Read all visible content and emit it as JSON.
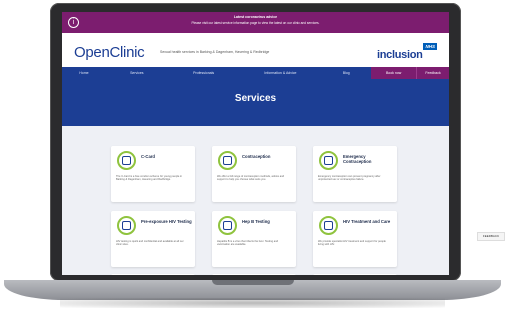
{
  "alert": {
    "icon": "info-icon",
    "title": "Latest coronavirus advice",
    "text": "Please visit our latest service information page to view the latest on our clinic and services."
  },
  "header": {
    "logo": "OpenClinic",
    "tagline": "Sexual health services in Barking & Dagenham, Havering & Redbridge",
    "partner_badge": "NHS",
    "partner_name": "inclusion"
  },
  "nav": {
    "items": [
      "Home",
      "Services",
      "Professionals",
      "Information & Advice",
      "Blog"
    ],
    "accent_items": [
      "Book now",
      "Feedback"
    ]
  },
  "hero": {
    "title": "Services"
  },
  "cards": [
    {
      "title": "C-Card",
      "icon": "c-card-icon",
      "desc": "The C-Card is a free condom scheme for young people in Barking & Dagenham, Havering and Redbridge."
    },
    {
      "title": "Contraception",
      "icon": "contraception-icon",
      "desc": "We offer a full range of contraception methods, advice and support to help you choose what suits you."
    },
    {
      "title": "Emergency Contraception",
      "icon": "emergency-contraception-icon",
      "desc": "Emergency contraception can prevent pregnancy after unprotected sex or contraceptive failure."
    },
    {
      "title": "Pre-exposure HIV Testing",
      "icon": "hiv-testing-icon",
      "desc": "HIV testing is quick and confidential and available at all our clinic sites."
    },
    {
      "title": "Hep B Testing",
      "icon": "hep-b-icon",
      "desc": "Hepatitis B is a virus that infects the liver. Testing and vaccination are available."
    },
    {
      "title": "HIV Treatment and Care",
      "icon": "hiv-ribbon-icon",
      "desc": "We provide specialist HIV treatment and support for people living with HIV."
    },
    {
      "title": "",
      "icon": "service-icon",
      "desc": ""
    },
    {
      "title": "",
      "icon": "service-icon",
      "desc": ""
    },
    {
      "title": "",
      "icon": "service-icon",
      "desc": ""
    }
  ],
  "feedback_tab": "FEEDBACK",
  "colors": {
    "accent": "#7c1d6f",
    "brand": "#1c3e94",
    "icon_ring": "#8fc33e"
  }
}
